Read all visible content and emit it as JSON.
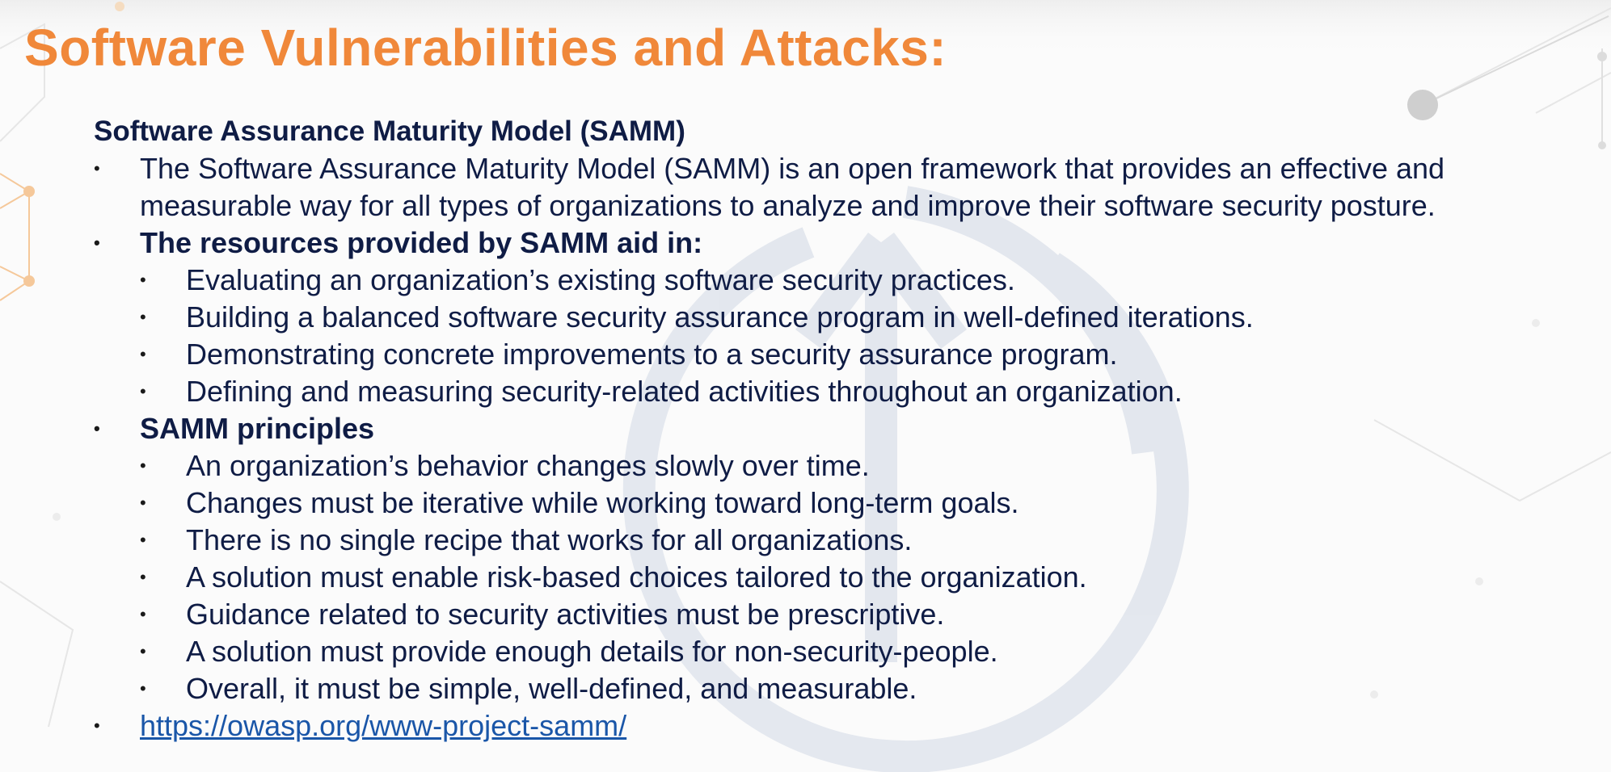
{
  "slide": {
    "title": "Software Vulnerabilities and Attacks:",
    "section_heading": "Software Assurance Maturity Model (SAMM)",
    "bullet_glyph": "•",
    "intro": {
      "line1": "The Software Assurance Maturity Model (SAMM) is an open framework that provides an effective and",
      "line2": "measurable way for all types of organizations to analyze and improve their software security posture."
    },
    "resources": {
      "heading": "The resources provided by SAMM aid in:",
      "items": [
        "Evaluating an organization’s existing software security practices.",
        "Building a balanced software security assurance program in well-defined iterations.",
        "Demonstrating concrete improvements to a security assurance program.",
        "Defining and measuring security-related activities throughout an organization."
      ]
    },
    "principles": {
      "heading": "SAMM principles",
      "items": [
        "An organization’s behavior changes slowly over time.",
        "Changes must be iterative while working toward long-term goals.",
        "There is no single recipe that works for all organizations.",
        "A solution must enable risk-based choices tailored to the organization.",
        "Guidance related to security activities must be prescriptive.",
        "A solution must provide enough details for non-security-people.",
        "Overall, it must be simple, well-defined, and measurable."
      ]
    },
    "link": "https://owasp.org/www-project-samm/"
  },
  "colors": {
    "title": "#f0883a",
    "text": "#0f1c45",
    "link": "#1a56a8",
    "watermark": "#dfe4ec"
  }
}
